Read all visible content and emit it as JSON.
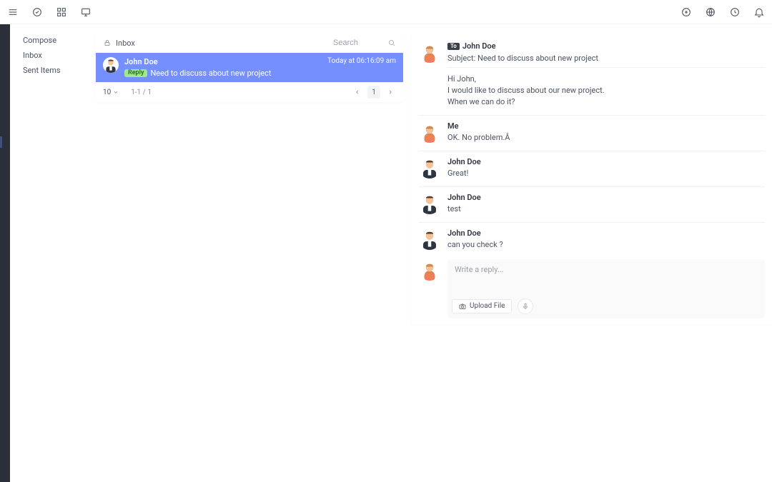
{
  "topbar": {},
  "sidenav": {
    "compose": "Compose",
    "inbox": "Inbox",
    "sent": "Sent Items"
  },
  "inbox": {
    "title": "Inbox",
    "search_placeholder": "Search",
    "page_size": "10",
    "range": "1-1 / 1",
    "page_current": "1",
    "mail": {
      "from": "John Doe",
      "time": "Today at 06:16:09 am",
      "reply_label": "Reply",
      "subject": "Need to discuss about new project"
    }
  },
  "thread": {
    "messages": [
      {
        "to_label": "To",
        "who": "John Doe",
        "subject_line": "Subject: Need to discuss about new project",
        "body": "Hi John,\nI would like to discuss about our new project.\nWhen we can do it?",
        "avatar": "female"
      },
      {
        "who": "Me",
        "body": "OK. No problem.Â",
        "avatar": "female"
      },
      {
        "who": "John Doe",
        "body": "Great!",
        "avatar": "male"
      },
      {
        "who": "John Doe",
        "body": "test",
        "avatar": "male"
      },
      {
        "who": "John Doe",
        "body": "can you check ?",
        "avatar": "male"
      }
    ],
    "reply_placeholder": "Write a reply...",
    "upload_label": "Upload File"
  }
}
